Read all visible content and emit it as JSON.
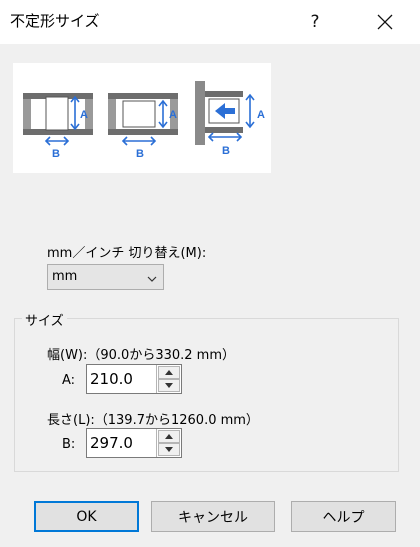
{
  "window": {
    "title": "不定形サイズ",
    "help_label": "?"
  },
  "illustration": {
    "label_a": "A",
    "label_b": "B"
  },
  "units": {
    "label": "mm／インチ 切り替え(M):",
    "selected": "mm"
  },
  "size_group": {
    "title": "サイズ",
    "width": {
      "label": "幅(W):（90.0から330.2 mm）",
      "field_label": "A:",
      "value": "210.0"
    },
    "length": {
      "label": "長さ(L):（139.7から1260.0 mm）",
      "field_label": "B:",
      "value": "297.0"
    }
  },
  "buttons": {
    "ok": "OK",
    "cancel": "キャンセル",
    "help": "ヘルプ"
  },
  "colors": {
    "accent": "#0078d7",
    "illustration_blue": "#2b6fd6"
  }
}
